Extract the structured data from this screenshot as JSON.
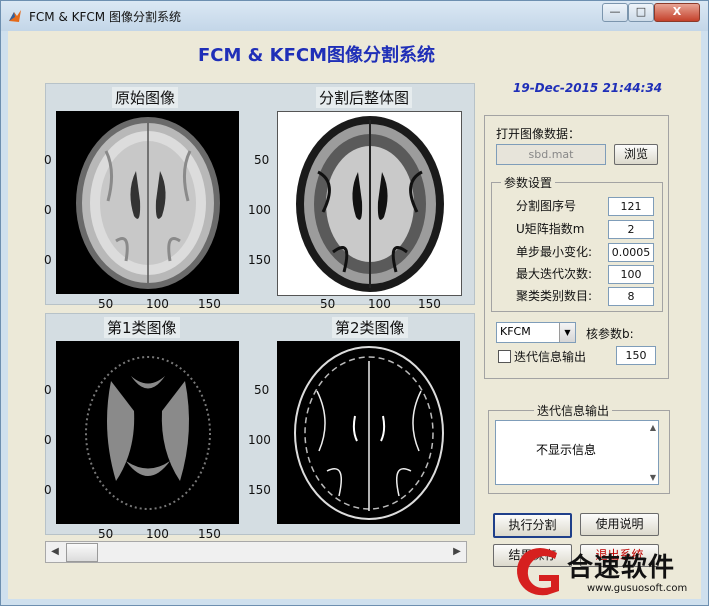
{
  "window": {
    "title": "FCM & KFCM 图像分割系统",
    "min_label": "—",
    "max_label": "□",
    "close_label": "X"
  },
  "app": {
    "title": "FCM & KFCM图像分割系统",
    "datetime": "19-Dec-2015 21:44:34"
  },
  "axes": {
    "original": {
      "title": "原始图像",
      "yticks": [
        "0",
        "0",
        "0",
        "0"
      ],
      "xticks": [
        "50",
        "100",
        "150"
      ]
    },
    "whole": {
      "title": "分割后整体图",
      "yticks": [
        "50",
        "100",
        "150"
      ],
      "xticks": [
        "50",
        "100",
        "150"
      ]
    },
    "class1": {
      "title": "第1类图像",
      "yticks": [
        "0",
        "0",
        "0"
      ],
      "xticks": [
        "50",
        "100",
        "150"
      ]
    },
    "class2": {
      "title": "第2类图像",
      "yticks": [
        "50",
        "100",
        "150"
      ],
      "xticks": [
        "50",
        "100",
        "150"
      ]
    }
  },
  "file": {
    "label": "打开图像数据：",
    "value": "sbd.mat",
    "browse": "浏览"
  },
  "params": {
    "group_title": "参数设置",
    "rows": [
      {
        "label": "分割图序号",
        "value": "121"
      },
      {
        "label": "U矩阵指数m",
        "value": "2"
      },
      {
        "label": "单步最小变化:",
        "value": "0.0005"
      },
      {
        "label": "最大迭代次数:",
        "value": "100"
      },
      {
        "label": "聚类类别数目:",
        "value": "8"
      }
    ]
  },
  "algorithm": {
    "selected": "KFCM",
    "kernel_label": "核参数b:",
    "kernel_value": "150",
    "checkbox_label": "迭代信息输出"
  },
  "info": {
    "group_title": "迭代信息输出",
    "text": "不显示信息",
    "up": "▲",
    "down": "▼"
  },
  "buttons": {
    "run": "执行分割",
    "help": "使用说明",
    "save": "结果保存",
    "exit": "退出系统"
  },
  "scroll": {
    "left": "◀",
    "right": "▶"
  },
  "watermark": {
    "text": "合速软件",
    "url": "www.gusuosoft.com"
  },
  "colors": {
    "title_blue": "#1f2fb8",
    "exit_red": "#c00000",
    "watermark_red": "#d6201f"
  }
}
